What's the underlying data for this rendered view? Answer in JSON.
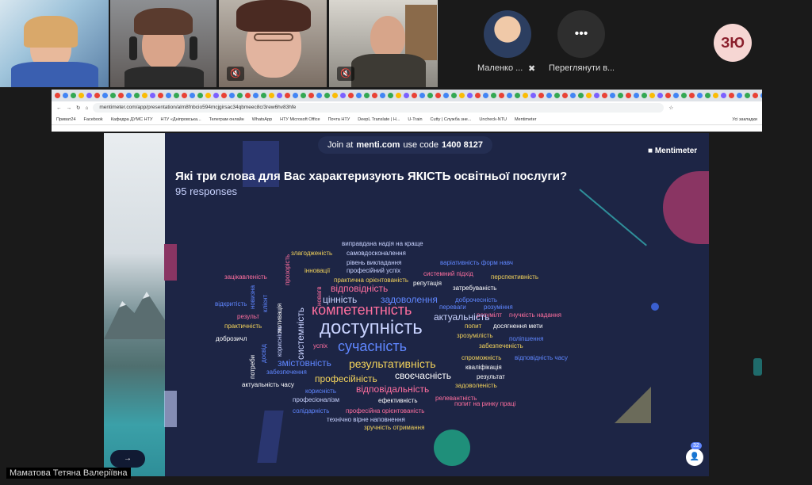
{
  "participants": [
    {
      "name": "Маленко ...",
      "initials": ""
    },
    {
      "name": "Переглянути в...",
      "initials": ""
    },
    {
      "name": "",
      "initials": "ЗЮ"
    }
  ],
  "self_label": "Маматова Тетяна Валеріївна",
  "browser": {
    "url": "mentimeter.com/app/presentation/alm8fnbcio594mcjgirsac34qbmeec8c/3rew6hv83hfe",
    "bookmarks": [
      "Приват24",
      "Facebook",
      "Кафедра ДУМС НТУ",
      "НТУ «Дніпровська...",
      "Телеграм онлайн",
      "WhatsApp",
      "НТУ Microsoft Office",
      "Почта НТУ",
      "DeepL Translate | Н...",
      "U-Train",
      "Cutty | Служба зне...",
      "Uncheck-NTU",
      "Mentimeter"
    ],
    "all_bookmarks": "Усі закладки"
  },
  "slide": {
    "join_prefix": "Join at",
    "join_site": "menti.com",
    "join_mid": "use code",
    "join_code": "1400 8127",
    "brand": "Mentimeter",
    "question": "Які три слова для Вас характеризують ЯКІСТЬ освітньої послуги?",
    "responses": "95 responses",
    "participants_count": "32",
    "words": [
      {
        "t": "виправдана надія на краще",
        "c": "#c9d3ff",
        "s": 8
      },
      {
        "t": "самовдосконалення",
        "c": "#c9d3ff",
        "s": 8
      },
      {
        "t": "злагодженість",
        "c": "#f3d35b",
        "s": 8
      },
      {
        "t": "рівень викладання",
        "c": "#c9d3ff",
        "s": 8
      },
      {
        "t": "варіативність форм навч",
        "c": "#5f86ff",
        "s": 8
      },
      {
        "t": "інновації",
        "c": "#f3d35b",
        "s": 8
      },
      {
        "t": "професійний успіх",
        "c": "#c9d3ff",
        "s": 8
      },
      {
        "t": "системний підхід",
        "c": "#ff6f9f",
        "s": 8
      },
      {
        "t": "зацікавленість",
        "c": "#ff6f9f",
        "s": 8
      },
      {
        "t": "практична орієнтованість",
        "c": "#f3d35b",
        "s": 8
      },
      {
        "t": "перспективність",
        "c": "#f3d35b",
        "s": 8
      },
      {
        "t": "репутація",
        "c": "#ffffff",
        "s": 8
      },
      {
        "t": "відповідність",
        "c": "#ff6f9f",
        "s": 12
      },
      {
        "t": "затребуваність",
        "c": "#ffffff",
        "s": 8
      },
      {
        "t": "цінність",
        "c": "#c9d3ff",
        "s": 12
      },
      {
        "t": "задоволення",
        "c": "#5f86ff",
        "s": 12
      },
      {
        "t": "доброчесність",
        "c": "#5f86ff",
        "s": 8
      },
      {
        "t": "відкритість",
        "c": "#5f86ff",
        "s": 8
      },
      {
        "t": "компетентність",
        "c": "#ff6f9f",
        "s": 18
      },
      {
        "t": "переваги",
        "c": "#5f86ff",
        "s": 8
      },
      {
        "t": "розуміння",
        "c": "#5f86ff",
        "s": 8
      },
      {
        "t": "розумілт",
        "c": "#ff6f9f",
        "s": 8
      },
      {
        "t": "актуальність",
        "c": "#c9d3ff",
        "s": 12
      },
      {
        "t": "гнучкість надання",
        "c": "#ff6f9f",
        "s": 8
      },
      {
        "t": "результ",
        "c": "#ff6f9f",
        "s": 8
      },
      {
        "t": "практичність",
        "c": "#f3d35b",
        "s": 8
      },
      {
        "t": "доступність",
        "c": "#c9d3ff",
        "s": 24
      },
      {
        "t": "попит",
        "c": "#f3d35b",
        "s": 8
      },
      {
        "t": "досягнення мети",
        "c": "#ffffff",
        "s": 8
      },
      {
        "t": "зрозумілість",
        "c": "#f3d35b",
        "s": 8
      },
      {
        "t": "доброзичл",
        "c": "#ffffff",
        "s": 8
      },
      {
        "t": "поліпшення",
        "c": "#5f86ff",
        "s": 8
      },
      {
        "t": "успіх",
        "c": "#ff6f9f",
        "s": 8
      },
      {
        "t": "сучасність",
        "c": "#5f86ff",
        "s": 18
      },
      {
        "t": "забезпеченість",
        "c": "#f3d35b",
        "s": 8
      },
      {
        "t": "спроможність",
        "c": "#f3d35b",
        "s": 8
      },
      {
        "t": "відповідність часу",
        "c": "#5f86ff",
        "s": 8
      },
      {
        "t": "змістовність",
        "c": "#5f86ff",
        "s": 12
      },
      {
        "t": "результативність",
        "c": "#f3d35b",
        "s": 14
      },
      {
        "t": "кваліфікація",
        "c": "#ffffff",
        "s": 8
      },
      {
        "t": "забезпечення",
        "c": "#5f86ff",
        "s": 8
      },
      {
        "t": "своєчасність",
        "c": "#ffffff",
        "s": 12
      },
      {
        "t": "професійність",
        "c": "#f3d35b",
        "s": 12
      },
      {
        "t": "результат",
        "c": "#ffffff",
        "s": 8
      },
      {
        "t": "актуальність часу",
        "c": "#ffffff",
        "s": 8
      },
      {
        "t": "задоволеність",
        "c": "#f3d35b",
        "s": 8
      },
      {
        "t": "корисність",
        "c": "#5f86ff",
        "s": 8
      },
      {
        "t": "відповідальність",
        "c": "#ff6f9f",
        "s": 12
      },
      {
        "t": "релевантність",
        "c": "#ff6f9f",
        "s": 8
      },
      {
        "t": "професіоналізм",
        "c": "#c9d3ff",
        "s": 8
      },
      {
        "t": "ефективність",
        "c": "#ffffff",
        "s": 8
      },
      {
        "t": "попит на ринку праці",
        "c": "#ff6f9f",
        "s": 8
      },
      {
        "t": "солідарність",
        "c": "#5f86ff",
        "s": 8
      },
      {
        "t": "професійна орієнтованість",
        "c": "#ff6f9f",
        "s": 8
      },
      {
        "t": "технічно вірне наповнення",
        "c": "#c9d3ff",
        "s": 8
      },
      {
        "t": "зручність отримання",
        "c": "#f3d35b",
        "s": 8
      }
    ],
    "vwords": [
      {
        "t": "системність",
        "c": "#c9d3ff",
        "s": 12
      },
      {
        "t": "прозорість",
        "c": "#ff6f9f",
        "s": 8
      },
      {
        "t": "новизна",
        "c": "#5f86ff",
        "s": 8
      },
      {
        "t": "клієнт",
        "c": "#5f86ff",
        "s": 8
      },
      {
        "t": "новагв",
        "c": "#ff6f9f",
        "s": 8
      },
      {
        "t": "мотивація",
        "c": "#ffffff",
        "s": 8
      },
      {
        "t": "корисність",
        "c": "#c9d3ff",
        "s": 8
      },
      {
        "t": "досвід",
        "c": "#5f86ff",
        "s": 8
      },
      {
        "t": "потреби",
        "c": "#ffffff",
        "s": 8
      }
    ]
  }
}
